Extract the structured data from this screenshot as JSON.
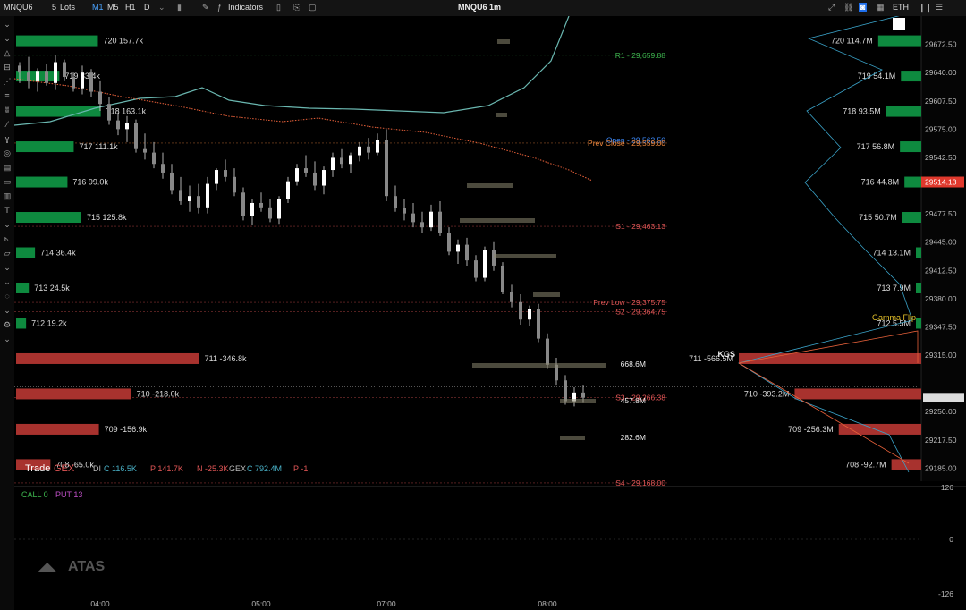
{
  "toolbar": {
    "symbol": "MNQU6",
    "lots": "5",
    "lots_label": "Lots",
    "timeframes": [
      "M1",
      "M5",
      "H1",
      "D"
    ],
    "active_timeframe": "M1",
    "indicators_label": "Indicators",
    "title": "MNQU6 1m",
    "exchange": "ETH"
  },
  "colors": {
    "gex_green": "#0e8a3f",
    "gex_red": "#a8322e",
    "bollinger": "#6ab7b0",
    "vwap": "#e8613a",
    "pivot_green": "#3fb950",
    "pivot_red": "#e25656",
    "open_blue": "#3d8bfd",
    "prev_close_orange": "#f0883e",
    "gamma_flip_yellow": "#e6c229",
    "profile_line": "#3d8bfd"
  },
  "chart_data": {
    "type": "candlestick",
    "price_axis": {
      "ticks": [
        "29672.50",
        "29640.00",
        "29607.50",
        "29575.00",
        "29542.50",
        "29477.50",
        "29445.00",
        "29412.50",
        "29380.00",
        "29347.50",
        "29315.00",
        "29250.00",
        "29217.50",
        "29185.00"
      ],
      "last_price": "29514.13",
      "ylim": [
        29170,
        29705
      ]
    },
    "time_axis": {
      "ticks": [
        "04:00",
        "05:00",
        "07:00",
        "08:00"
      ]
    },
    "levels": [
      {
        "label": "R1 - 29,659.88",
        "price": 29659.88,
        "color": "pivot_green"
      },
      {
        "label": "Open - 29,562.50",
        "price": 29562.5,
        "color": "open_blue"
      },
      {
        "label": "Prev Close - 29,559.00",
        "price": 29559.0,
        "color": "prev_close_orange"
      },
      {
        "label": "S1 - 29,463.13",
        "price": 29463.13,
        "color": "pivot_red"
      },
      {
        "label": "Prev Low - 29,375.75",
        "price": 29375.75,
        "color": "pivot_red"
      },
      {
        "label": "S2 - 29,364.75",
        "price": 29364.75,
        "color": "pivot_red"
      },
      {
        "label": "S3 - 29,266.38",
        "price": 29266.38,
        "color": "pivot_red"
      },
      {
        "label": "S4 - 29,168.00",
        "price": 29168.0,
        "color": "pivot_red"
      }
    ],
    "left_gex_bars": [
      {
        "label": "720 157.7k",
        "value": 157.7,
        "price": 29671
      },
      {
        "label": "719 83.4k",
        "value": 83.4,
        "price": 29638
      },
      {
        "label": "718 163.1k",
        "value": 163.1,
        "price": 29605
      },
      {
        "label": "717 111.1k",
        "value": 111.1,
        "price": 29572
      },
      {
        "label": "716 99.0k",
        "value": 99.0,
        "price": 29539
      },
      {
        "label": "715 125.8k",
        "value": 125.8,
        "price": 29506
      },
      {
        "label": "714 36.4k",
        "value": 36.4,
        "price": 29473
      },
      {
        "label": "713 24.5k",
        "value": 24.5,
        "price": 29440
      },
      {
        "label": "712 19.2k",
        "value": 19.2,
        "price": 29407
      },
      {
        "label": "711 -346.8k",
        "value": -346.8,
        "price": 29374
      },
      {
        "label": "710 -218.0k",
        "value": -218.0,
        "price": 29341
      },
      {
        "label": "709 -156.9k",
        "value": -156.9,
        "price": 29308
      },
      {
        "label": "708 -65.0k",
        "value": -65.0,
        "price": 29275
      }
    ],
    "right_gex_bars": [
      {
        "label": "720 114.7M",
        "value": 114.7
      },
      {
        "label": "719 54.1M",
        "value": 54.1
      },
      {
        "label": "718 93.5M",
        "value": 93.5
      },
      {
        "label": "717 56.8M",
        "value": 56.8
      },
      {
        "label": "716 44.8M",
        "value": 44.8
      },
      {
        "label": "715 50.7M",
        "value": 50.7
      },
      {
        "label": "714 13.1M",
        "value": 13.1
      },
      {
        "label": "713 7.9M",
        "value": 7.9
      },
      {
        "label": "712 5.5M",
        "value": 5.5
      },
      {
        "label": "711 -566.5M",
        "value": -566.5
      },
      {
        "label": "710 -393.2M",
        "value": -393.2
      },
      {
        "label": "709 -256.3M",
        "value": -256.3
      },
      {
        "label": "708 -92.7M",
        "value": -92.7
      }
    ],
    "annotations": {
      "gamma_flip": "Gamma Flip",
      "kgs": "KGS",
      "vol_668": "668.6M",
      "vol_457": "457.8M",
      "vol_282": "282.6M"
    },
    "info_bar": {
      "brand_a": "Trade",
      "brand_b": "GEX",
      "di_label": "DI",
      "c_label": "C 116.5K",
      "p_label": "P 141.7K",
      "n_label": "N -25.3K",
      "gex_label": "GEX",
      "gex_c": "C 792.4M",
      "gex_p": "P -1"
    },
    "lower_pane": {
      "call": "CALL 0",
      "put": "PUT 13",
      "ticks": [
        "126",
        "0",
        "-126"
      ],
      "logo": "ATAS"
    },
    "candles": [
      [
        29648,
        29652,
        29628,
        29640
      ],
      [
        29640,
        29658,
        29622,
        29630
      ],
      [
        29630,
        29645,
        29618,
        29642
      ],
      [
        29642,
        29650,
        29625,
        29628
      ],
      [
        29628,
        29660,
        29620,
        29652
      ],
      [
        29652,
        29655,
        29630,
        29635
      ],
      [
        29635,
        29640,
        29618,
        29622
      ],
      [
        29622,
        29648,
        29615,
        29640
      ],
      [
        29640,
        29644,
        29612,
        29618
      ],
      [
        29618,
        29630,
        29596,
        29604
      ],
      [
        29604,
        29612,
        29580,
        29585
      ],
      [
        29585,
        29594,
        29568,
        29575
      ],
      [
        29575,
        29590,
        29560,
        29582
      ],
      [
        29582,
        29586,
        29548,
        29552
      ],
      [
        29552,
        29570,
        29540,
        29548
      ],
      [
        29548,
        29560,
        29530,
        29535
      ],
      [
        29535,
        29548,
        29518,
        29525
      ],
      [
        29525,
        29535,
        29500,
        29505
      ],
      [
        29505,
        29520,
        29488,
        29492
      ],
      [
        29492,
        29510,
        29480,
        29498
      ],
      [
        29498,
        29512,
        29478,
        29485
      ],
      [
        29485,
        29520,
        29478,
        29512
      ],
      [
        29512,
        29530,
        29505,
        29528
      ],
      [
        29528,
        29540,
        29515,
        29520
      ],
      [
        29520,
        29530,
        29498,
        29502
      ],
      [
        29502,
        29508,
        29470,
        29475
      ],
      [
        29475,
        29495,
        29465,
        29490
      ],
      [
        29490,
        29502,
        29480,
        29485
      ],
      [
        29485,
        29495,
        29468,
        29472
      ],
      [
        29472,
        29498,
        29466,
        29495
      ],
      [
        29495,
        29520,
        29490,
        29515
      ],
      [
        29515,
        29535,
        29510,
        29530
      ],
      [
        29530,
        29545,
        29520,
        29525
      ],
      [
        29525,
        29538,
        29505,
        29510
      ],
      [
        29510,
        29532,
        29500,
        29528
      ],
      [
        29528,
        29548,
        29520,
        29542
      ],
      [
        29542,
        29552,
        29530,
        29535
      ],
      [
        29535,
        29548,
        29525,
        29545
      ],
      [
        29545,
        29560,
        29538,
        29555
      ],
      [
        29555,
        29565,
        29540,
        29548
      ],
      [
        29548,
        29570,
        29545,
        29562
      ],
      [
        29562,
        29575,
        29492,
        29498
      ],
      [
        29498,
        29510,
        29480,
        29484
      ],
      [
        29484,
        29495,
        29470,
        29478
      ],
      [
        29478,
        29490,
        29462,
        29468
      ],
      [
        29468,
        29480,
        29455,
        29462
      ],
      [
        29462,
        29488,
        29458,
        29480
      ],
      [
        29480,
        29492,
        29452,
        29456
      ],
      [
        29456,
        29462,
        29430,
        29434
      ],
      [
        29434,
        29448,
        29420,
        29442
      ],
      [
        29442,
        29450,
        29418,
        29424
      ],
      [
        29424,
        29430,
        29400,
        29404
      ],
      [
        29404,
        29440,
        29400,
        29436
      ],
      [
        29436,
        29445,
        29412,
        29418
      ],
      [
        29418,
        29422,
        29385,
        29388
      ],
      [
        29388,
        29396,
        29370,
        29376
      ],
      [
        29376,
        29385,
        29350,
        29356
      ],
      [
        29356,
        29372,
        29348,
        29368
      ],
      [
        29368,
        29374,
        29330,
        29334
      ],
      [
        29334,
        29340,
        29300,
        29304
      ],
      [
        29304,
        29312,
        29280,
        29286
      ],
      [
        29286,
        29292,
        29258,
        29262
      ],
      [
        29262,
        29278,
        29256,
        29272
      ],
      [
        29272,
        29280,
        29260,
        29266
      ]
    ]
  }
}
